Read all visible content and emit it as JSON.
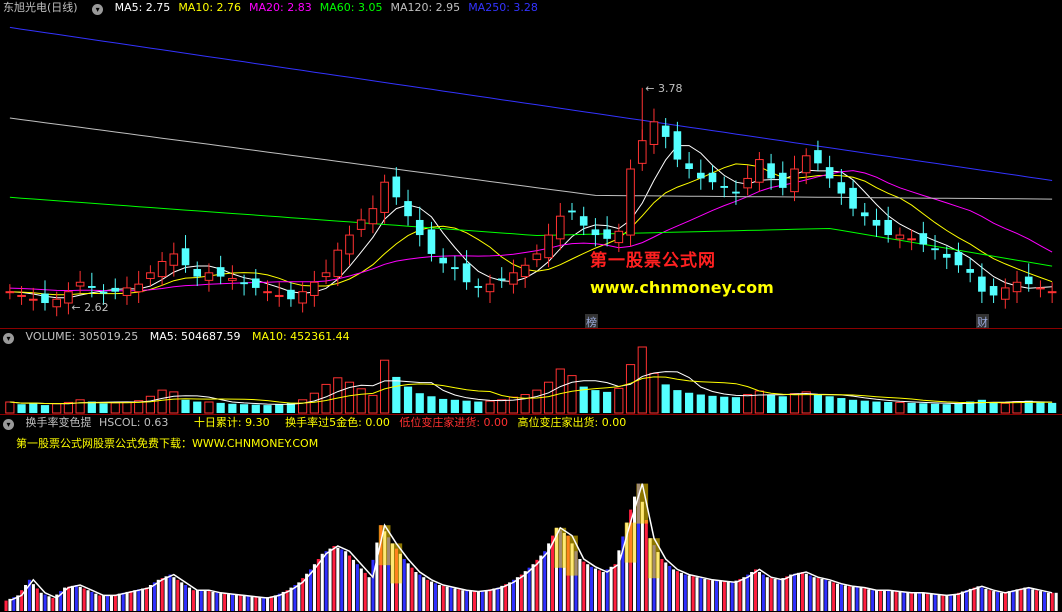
{
  "main": {
    "title": "东旭光电(日线)",
    "ma": [
      {
        "label": "MA5: 2.75",
        "color": "#ffffff"
      },
      {
        "label": "MA10: 2.76",
        "color": "#ffff00"
      },
      {
        "label": "MA20: 2.83",
        "color": "#ff00ff"
      },
      {
        "label": "MA60: 3.05",
        "color": "#00ff00"
      },
      {
        "label": "MA120: 2.95",
        "color": "#c0c0c0"
      },
      {
        "label": "MA250: 3.28",
        "color": "#3333ff"
      }
    ],
    "high_label": "3.78",
    "low_label": "2.62",
    "tag1": "榜",
    "tag2": "财",
    "watermark_cn": "第一股票公式网",
    "watermark_url": "www.chnmoney.com"
  },
  "volume": {
    "label": "VOLUME: 305019.25",
    "ma5": "MA5: 504687.59",
    "ma10": "MA10: 452361.44"
  },
  "indicator": {
    "name": "换手率变色提",
    "hscol": "HSCOL: 0.63",
    "sum10": "十日累计: 9.30",
    "over5": "换手率过5金色: 0.00",
    "low": "低位变庄家进货: 0.00",
    "high": "高位变庄家出货: 0.00",
    "promo": "第一股票公式网股票公式免费下载：WWW.CHNMONEY.COM"
  },
  "chart_data": [
    {
      "type": "candlestick",
      "ylim": [
        2.55,
        4.15
      ],
      "close": [
        2.7,
        2.68,
        2.66,
        2.64,
        2.66,
        2.7,
        2.75,
        2.72,
        2.69,
        2.7,
        2.72,
        2.74,
        2.8,
        2.86,
        2.9,
        2.84,
        2.78,
        2.8,
        2.78,
        2.77,
        2.74,
        2.72,
        2.7,
        2.68,
        2.66,
        2.7,
        2.75,
        2.8,
        2.92,
        3.0,
        3.08,
        3.14,
        3.28,
        3.2,
        3.1,
        3.0,
        2.9,
        2.85,
        2.82,
        2.75,
        2.72,
        2.74,
        2.76,
        2.8,
        2.84,
        2.9,
        3.0,
        3.1,
        3.12,
        3.05,
        3.0,
        2.98,
        3.02,
        3.35,
        3.5,
        3.6,
        3.52,
        3.4,
        3.35,
        3.3,
        3.28,
        3.25,
        3.22,
        3.3,
        3.4,
        3.3,
        3.25,
        3.35,
        3.42,
        3.38,
        3.3,
        3.22,
        3.14,
        3.1,
        3.05,
        3.0,
        3.0,
        2.98,
        2.95,
        2.92,
        2.88,
        2.84,
        2.8,
        2.7,
        2.68,
        2.72,
        2.75,
        2.74,
        2.72,
        2.7
      ]
    },
    {
      "type": "bar",
      "ylim": [
        0,
        1500000
      ],
      "values": [
        250000,
        200000,
        230000,
        180000,
        210000,
        240000,
        300000,
        260000,
        220000,
        230000,
        250000,
        280000,
        380000,
        520000,
        480000,
        300000,
        260000,
        250000,
        230000,
        210000,
        200000,
        190000,
        180000,
        200000,
        230000,
        300000,
        450000,
        650000,
        800000,
        700000,
        550000,
        400000,
        1200000,
        820000,
        600000,
        450000,
        380000,
        320000,
        300000,
        280000,
        260000,
        270000,
        300000,
        360000,
        420000,
        520000,
        700000,
        1000000,
        850000,
        600000,
        520000,
        480000,
        560000,
        1100000,
        1500000,
        900000,
        650000,
        520000,
        460000,
        420000,
        390000,
        370000,
        360000,
        420000,
        500000,
        420000,
        380000,
        440000,
        480000,
        420000,
        380000,
        340000,
        300000,
        280000,
        260000,
        250000,
        240000,
        230000,
        220000,
        210000,
        200000,
        210000,
        260000,
        300000,
        250000,
        220000,
        260000,
        280000,
        250000,
        230000
      ]
    },
    {
      "type": "bar",
      "ylim": [
        0,
        12
      ],
      "values": [
        0.8,
        1.2,
        2.4,
        1.4,
        1.0,
        1.8,
        2.0,
        1.6,
        1.2,
        1.2,
        1.4,
        1.6,
        1.8,
        2.4,
        2.8,
        2.2,
        1.6,
        1.6,
        1.4,
        1.3,
        1.2,
        1.1,
        1.0,
        1.2,
        1.6,
        2.2,
        3.2,
        4.4,
        5.0,
        4.6,
        3.6,
        2.6,
        6.6,
        5.2,
        4.0,
        3.0,
        2.4,
        2.0,
        1.8,
        1.6,
        1.5,
        1.6,
        1.8,
        2.2,
        2.8,
        3.6,
        4.6,
        6.4,
        5.8,
        4.0,
        3.4,
        3.0,
        3.6,
        6.8,
        9.8,
        5.6,
        4.0,
        3.2,
        2.8,
        2.6,
        2.4,
        2.3,
        2.2,
        2.6,
        3.2,
        2.6,
        2.4,
        2.8,
        3.0,
        2.6,
        2.4,
        2.1,
        1.9,
        1.8,
        1.6,
        1.6,
        1.5,
        1.4,
        1.4,
        1.3,
        1.2,
        1.3,
        1.6,
        1.9,
        1.6,
        1.4,
        1.6,
        1.8,
        1.6,
        1.4
      ]
    }
  ]
}
